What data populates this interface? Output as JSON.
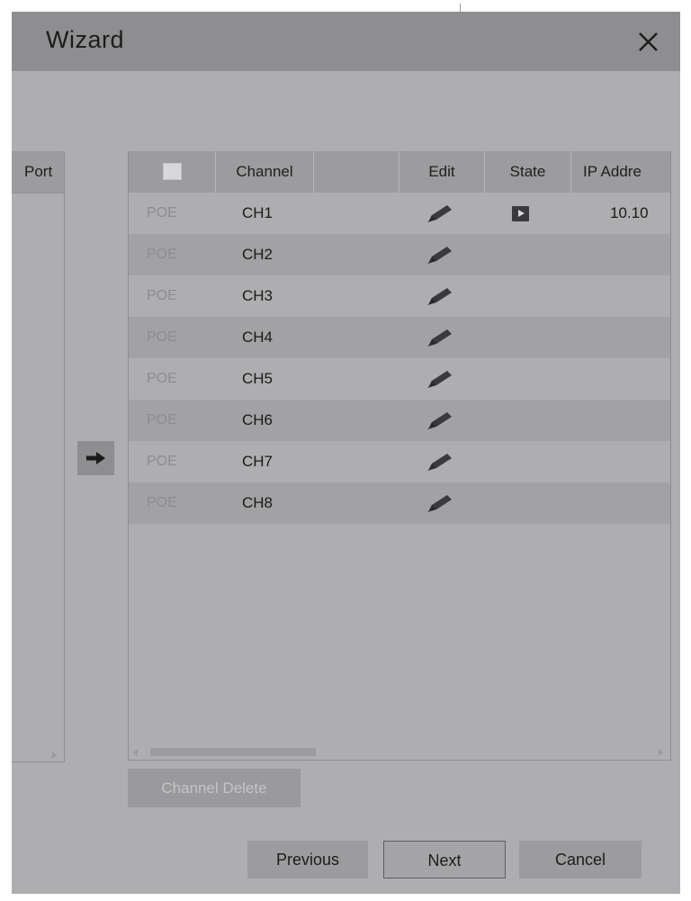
{
  "window": {
    "title": "Wizard"
  },
  "left_panel": {
    "header": "Port"
  },
  "table": {
    "columns": {
      "channel": "Channel",
      "blank": "",
      "edit": "Edit",
      "state": "State",
      "ip": "IP Addre"
    },
    "rows": [
      {
        "type": "POE",
        "channel": "CH1",
        "state": "play-icon",
        "ip": "10.10"
      },
      {
        "type": "POE",
        "channel": "CH2",
        "state": "",
        "ip": ""
      },
      {
        "type": "POE",
        "channel": "CH3",
        "state": "",
        "ip": ""
      },
      {
        "type": "POE",
        "channel": "CH4",
        "state": "",
        "ip": ""
      },
      {
        "type": "POE",
        "channel": "CH5",
        "state": "",
        "ip": ""
      },
      {
        "type": "POE",
        "channel": "CH6",
        "state": "",
        "ip": ""
      },
      {
        "type": "POE",
        "channel": "CH7",
        "state": "",
        "ip": ""
      },
      {
        "type": "POE",
        "channel": "CH8",
        "state": "",
        "ip": ""
      }
    ]
  },
  "actions": {
    "channel_delete": "Channel Delete",
    "previous": "Previous",
    "next": "Next",
    "cancel": "Cancel"
  },
  "colors": {
    "background": "#aeaeb0",
    "titlebar": "#8e8e90",
    "header": "#9c9c9e",
    "row_alt": "#a2a2a4"
  }
}
